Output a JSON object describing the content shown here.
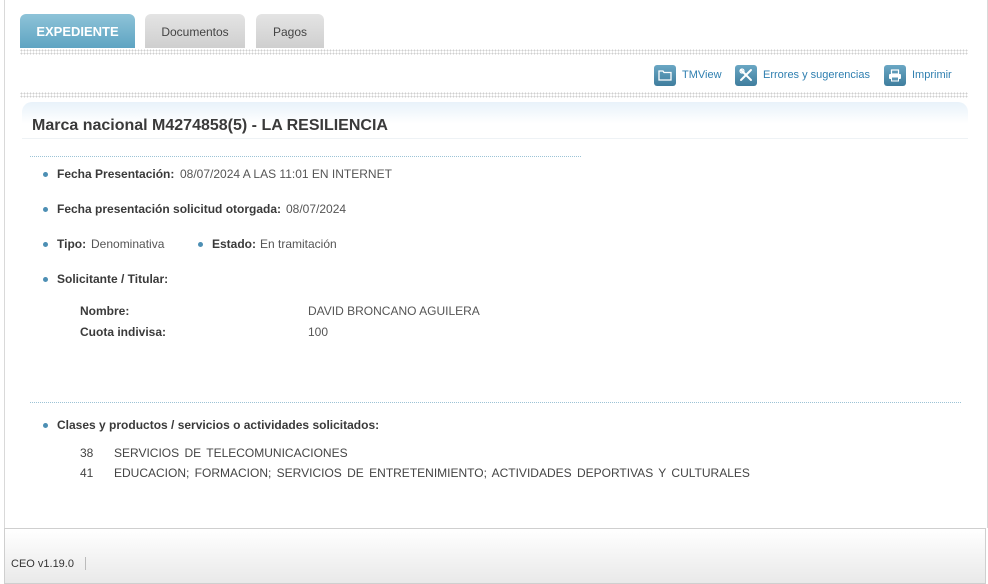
{
  "tabs": [
    {
      "label": "EXPEDIENTE",
      "active": true
    },
    {
      "label": "Documentos",
      "active": false
    },
    {
      "label": "Pagos",
      "active": false
    }
  ],
  "toolbar": {
    "tmview": {
      "label": "TMView",
      "icon": "folder-icon"
    },
    "errores": {
      "label": "Errores y sugerencias",
      "icon": "tools-icon"
    },
    "imprimir": {
      "label": "Imprimir",
      "icon": "printer-icon"
    }
  },
  "title": "Marca nacional M4274858(5) - LA RESILIENCIA",
  "fields": {
    "fecha_presentacion": {
      "label": "Fecha Presentación:",
      "value": "08/07/2024 A LAS 11:01 EN INTERNET"
    },
    "fecha_otorgada": {
      "label": "Fecha presentación solicitud otorgada:",
      "value": "08/07/2024"
    },
    "tipo": {
      "label": "Tipo:",
      "value": "Denominativa"
    },
    "estado": {
      "label": "Estado:",
      "value": "En tramitación"
    },
    "solicitante": {
      "label": "Solicitante / Titular:"
    },
    "nombre": {
      "label": "Nombre:",
      "value": "DAVID BRONCANO AGUILERA"
    },
    "cuota": {
      "label": "Cuota indivisa:",
      "value": "100"
    }
  },
  "clases": {
    "label": "Clases y productos / servicios o actividades solicitados:",
    "items": [
      {
        "num": "38",
        "text": "SERVICIOS DE TELECOMUNICACIONES"
      },
      {
        "num": "41",
        "text": "EDUCACION; FORMACION; SERVICIOS DE ENTRETENIMIENTO; ACTIVIDADES DEPORTIVAS Y CULTURALES"
      }
    ]
  },
  "footer": {
    "version": "CEO v1.19.0"
  },
  "colors": {
    "accent": "#5ea4c2",
    "link": "#2f7fb0",
    "bullet": "#4d8fb4"
  }
}
